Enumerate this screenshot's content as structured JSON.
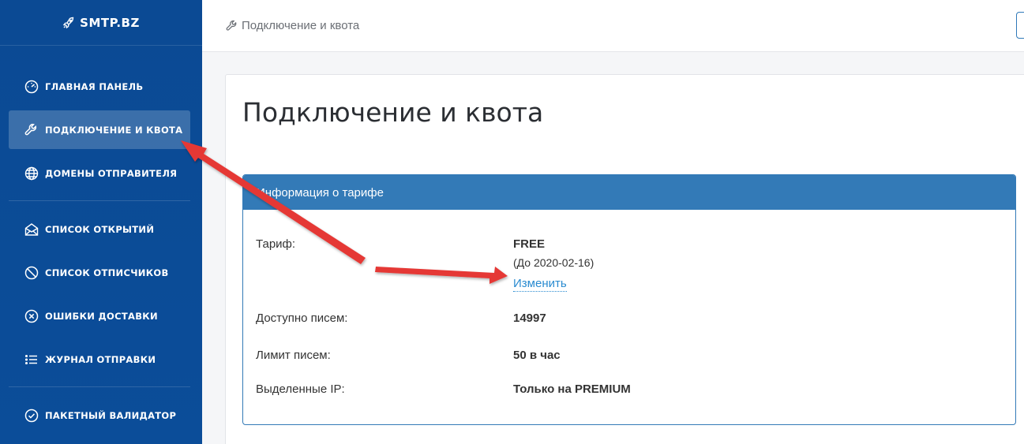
{
  "app": {
    "logo_text": "SMTP.BZ"
  },
  "sidebar": {
    "items": [
      {
        "label": "Главная панель",
        "icon": "dashboard-icon"
      },
      {
        "label": "Подключение и квота",
        "icon": "wrench-icon"
      },
      {
        "label": "Домены отправителя",
        "icon": "globe-icon"
      },
      {
        "label": "Список открытий",
        "icon": "envelope-open-icon"
      },
      {
        "label": "Список отписчиков",
        "icon": "ban-icon"
      },
      {
        "label": "Ошибки доставки",
        "icon": "x-circle-icon"
      },
      {
        "label": "Журнал отправки",
        "icon": "list-icon"
      },
      {
        "label": "Пакетный валидатор",
        "icon": "check-circle-icon"
      }
    ],
    "active_index": 1
  },
  "header": {
    "breadcrumb": "Подключение и квота"
  },
  "main": {
    "title": "Подключение и квота",
    "panel": {
      "heading": "Информация о тарифе",
      "tariff_label": "Тариф:",
      "tariff_value": "FREE",
      "tariff_until": "(До 2020-02-16)",
      "change_link": "Изменить",
      "available_label": "Доступно писем:",
      "available_value": "14997",
      "limit_label": "Лимит писем:",
      "limit_value": "50 в час",
      "ip_label": "Выделенные IP:",
      "ip_value": "Только на PREMIUM"
    }
  },
  "colors": {
    "sidebar_bg": "#0b4a94",
    "accent": "#337ab7",
    "link": "#2a8bd0",
    "annotation_arrow": "#e53935"
  }
}
